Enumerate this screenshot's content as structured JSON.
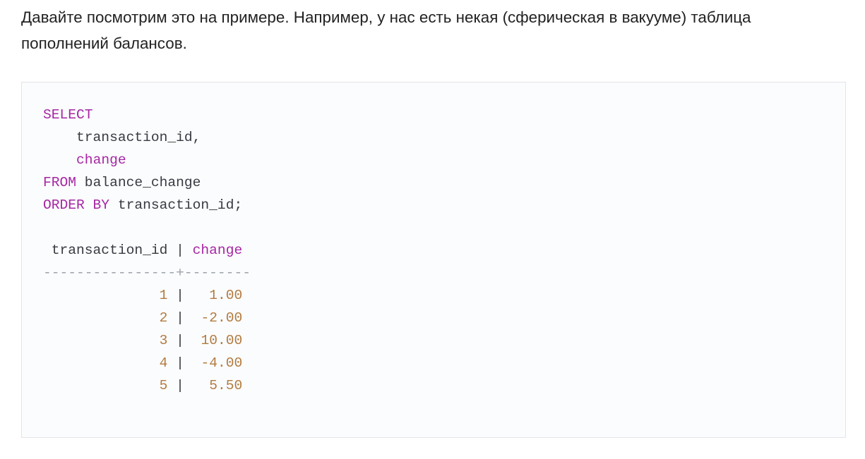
{
  "colors": {
    "keyword": "#a626a4",
    "number": "#b27b40",
    "text": "#383a42",
    "separator": "#9da2ab",
    "code_background": "#fbfcfd",
    "code_border": "#e2e4e8"
  },
  "paragraph": {
    "text": "Давайте посмотрим это на примере. Например, у нас есть некая (сферическая в вакууме) таблица пополнений балансов."
  },
  "code": {
    "query": {
      "select_kw": "SELECT",
      "col1": "    transaction_id,",
      "col2_indent": "    ",
      "col2": "change",
      "from_kw": "FROM",
      "from_rest": " balance_change",
      "order_kw": "ORDER BY",
      "order_rest": " transaction_id;"
    },
    "result": {
      "header_left": " transaction_id | ",
      "header_right": "change",
      "separator_line": "----------------+--------",
      "pipe": " |  ",
      "rows": [
        {
          "id_pad": "              ",
          "id": "1",
          "val_pad": " ",
          "value": "1.00"
        },
        {
          "id_pad": "              ",
          "id": "2",
          "val_pad": "",
          "value": "-2.00"
        },
        {
          "id_pad": "              ",
          "id": "3",
          "val_pad": "",
          "value": "10.00"
        },
        {
          "id_pad": "              ",
          "id": "4",
          "val_pad": "",
          "value": "-4.00"
        },
        {
          "id_pad": "              ",
          "id": "5",
          "val_pad": " ",
          "value": "5.50"
        }
      ]
    }
  }
}
